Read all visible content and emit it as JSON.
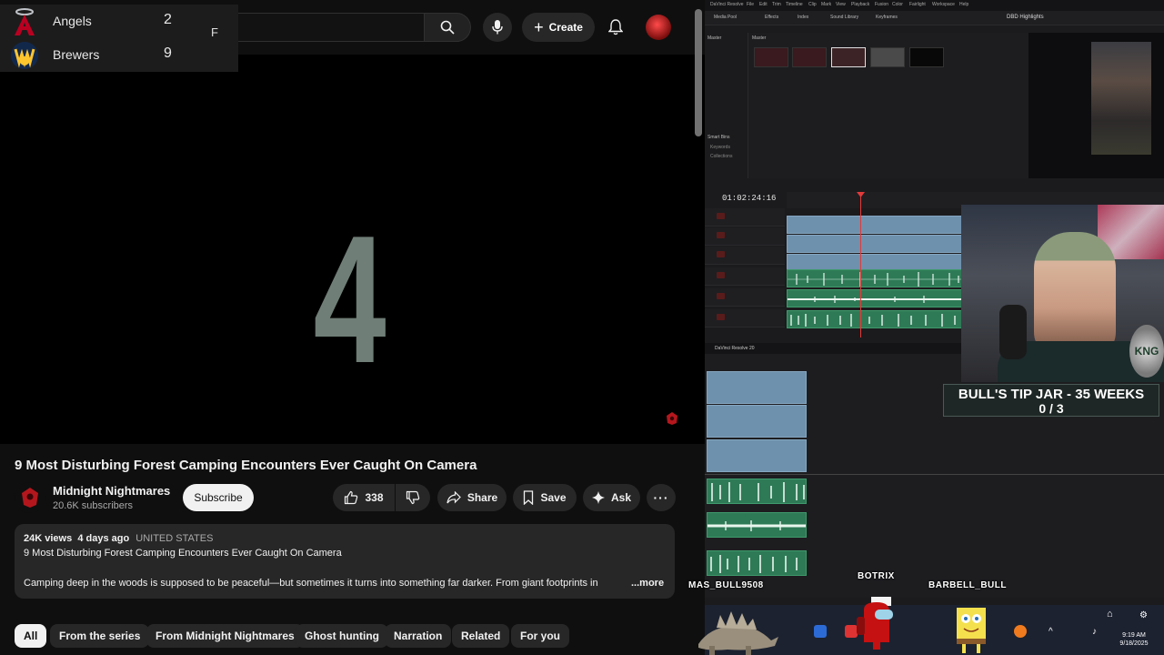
{
  "scoreboard": {
    "teams": [
      {
        "name": "Angels",
        "score": "2",
        "logo": "angels-logo-icon",
        "color": "#ba0021"
      },
      {
        "name": "Brewers",
        "score": "9",
        "logo": "brewers-logo-icon",
        "color": "#ffc52f"
      }
    ],
    "status": "F"
  },
  "youtube": {
    "header": {
      "create_label": "Create"
    },
    "player": {
      "countdown": "4"
    },
    "video": {
      "title": "9 Most Disturbing Forest Camping Encounters Ever Caught On Camera",
      "channel_name": "Midnight Nightmares",
      "subscribers": "20.6K subscribers",
      "subscribe_label": "Subscribe",
      "like_count": "338",
      "share_label": "Share",
      "save_label": "Save",
      "ask_label": "Ask"
    },
    "description": {
      "views": "24K views",
      "age": "4 days ago",
      "country": "UNITED STATES",
      "line1": "9 Most Disturbing Forest Camping Encounters Ever Caught On Camera",
      "line2": "Camping deep in the woods is supposed to be peaceful—but sometimes it turns into something far darker. From giant footprints in",
      "more": "...more"
    },
    "chips": [
      "All",
      "From the series",
      "From Midnight Nightmares",
      "Ghost hunting",
      "Narration",
      "Related",
      "For you"
    ],
    "accent_color": "#ff0000"
  },
  "resolve": {
    "menu": [
      "DaVinci Resolve",
      "File",
      "Edit",
      "Trim",
      "Timeline",
      "Clip",
      "Mark",
      "View",
      "Playback",
      "Fusion",
      "Color",
      "Fairlight",
      "Workspace",
      "Help"
    ],
    "toolbar": [
      "Media Pool",
      "Effects",
      "Index",
      "Sound Library",
      "Keyframes"
    ],
    "project_name": "DBD Highlights",
    "pool_label": "Master",
    "bins": [
      "Master",
      "Smart Bins",
      "Keywords",
      "Collections"
    ],
    "timecode": "01:02:24:16",
    "status_label": "DaVinci Resolve 20"
  },
  "overlay": {
    "tip_jar_title": "BULL'S TIP JAR - 35 WEEKS",
    "tip_jar_count": "0 / 3",
    "chatters": [
      "MAS_BULL9508",
      "BOTRIX",
      "BARBELL_BULL"
    ],
    "webcam_badge": "KNG"
  },
  "taskbar": {
    "time": "9:19 AM",
    "date": "9/18/2025"
  }
}
